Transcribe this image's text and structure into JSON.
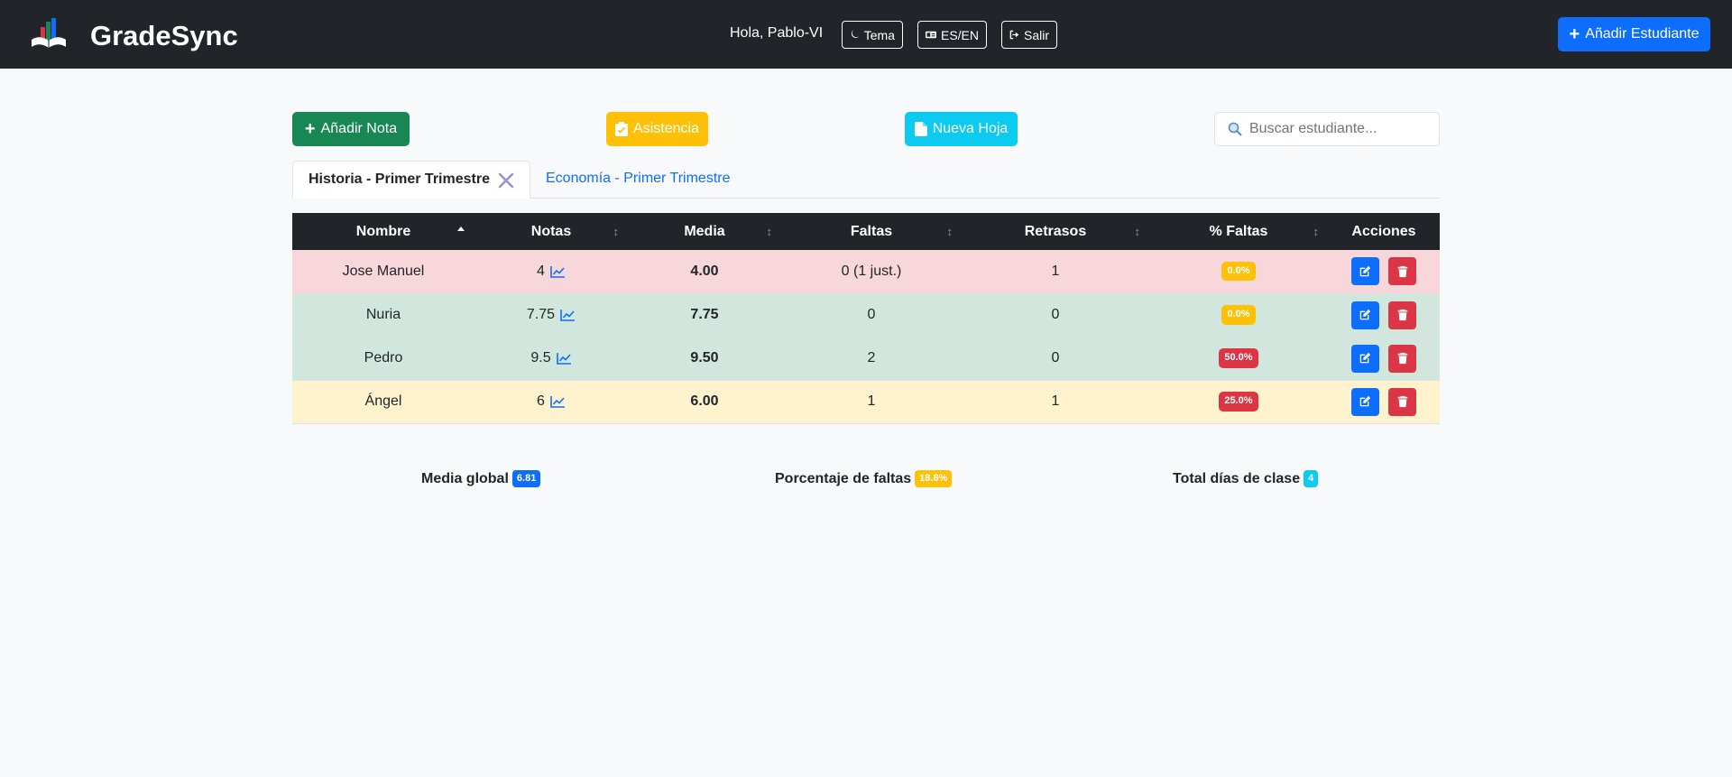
{
  "app": {
    "name": "GradeSync"
  },
  "navbar": {
    "greeting": "Hola, Pablo-VI",
    "theme_label": "Tema",
    "lang_label": "ES/EN",
    "logout_label": "Salir",
    "add_student_label": "Añadir Estudiante"
  },
  "toolbar": {
    "add_grade_label": "Añadir Nota",
    "attendance_label": "Asistencia",
    "new_sheet_label": "Nueva Hoja",
    "search_placeholder": "Buscar estudiante...",
    "search_value": ""
  },
  "tabs": [
    {
      "label": "Historia - Primer Trimestre",
      "active": true
    },
    {
      "label": "Economía - Primer Trimestre",
      "active": false
    }
  ],
  "table": {
    "headers": [
      "Nombre",
      "Notas",
      "Media",
      "Faltas",
      "Retrasos",
      "% Faltas",
      "Acciones"
    ],
    "sorted_column": "Nombre",
    "rows": [
      {
        "nombre": "Jose Manuel",
        "notas": "4",
        "media": "4.00",
        "faltas": "0 (1 just.)",
        "retrasos": "1",
        "pct_faltas": "0.0%",
        "status": "red",
        "pct_color": "yellow"
      },
      {
        "nombre": "Nuria",
        "notas": "7.75",
        "media": "7.75",
        "faltas": "0",
        "retrasos": "0",
        "pct_faltas": "0.0%",
        "status": "green",
        "pct_color": "yellow"
      },
      {
        "nombre": "Pedro",
        "notas": "9.5",
        "media": "9.50",
        "faltas": "2",
        "retrasos": "0",
        "pct_faltas": "50.0%",
        "status": "green",
        "pct_color": "red"
      },
      {
        "nombre": "Ángel",
        "notas": "6",
        "media": "6.00",
        "faltas": "1",
        "retrasos": "1",
        "pct_faltas": "25.0%",
        "status": "yellow",
        "pct_color": "red"
      }
    ]
  },
  "summary": {
    "media_global_label": "Media global",
    "media_global_value": "6.81",
    "porcentaje_faltas_label": "Porcentaje de faltas",
    "porcentaje_faltas_value": "18.8%",
    "total_dias_label": "Total días de clase",
    "total_dias_value": "4"
  },
  "colors": {
    "navbar_bg": "#212529",
    "primary": "#0d6efd",
    "success": "#198754",
    "warning": "#ffc107",
    "info": "#0dcaf0",
    "danger": "#dc3545",
    "row_red": "#f8d7da",
    "row_green": "#d1e7dd",
    "row_yellow": "#fff3cd"
  },
  "icons": {
    "brand": "book-chart-logo-icon",
    "theme": "moon-icon",
    "lang": "language-icon",
    "logout": "logout-icon",
    "add": "plus-icon",
    "attendance": "clipboard-check-icon",
    "new_sheet": "file-icon",
    "search": "search-icon",
    "tab_close": "close-icon",
    "notes_chart": "line-chart-icon",
    "edit": "edit-icon",
    "delete": "trash-icon"
  }
}
